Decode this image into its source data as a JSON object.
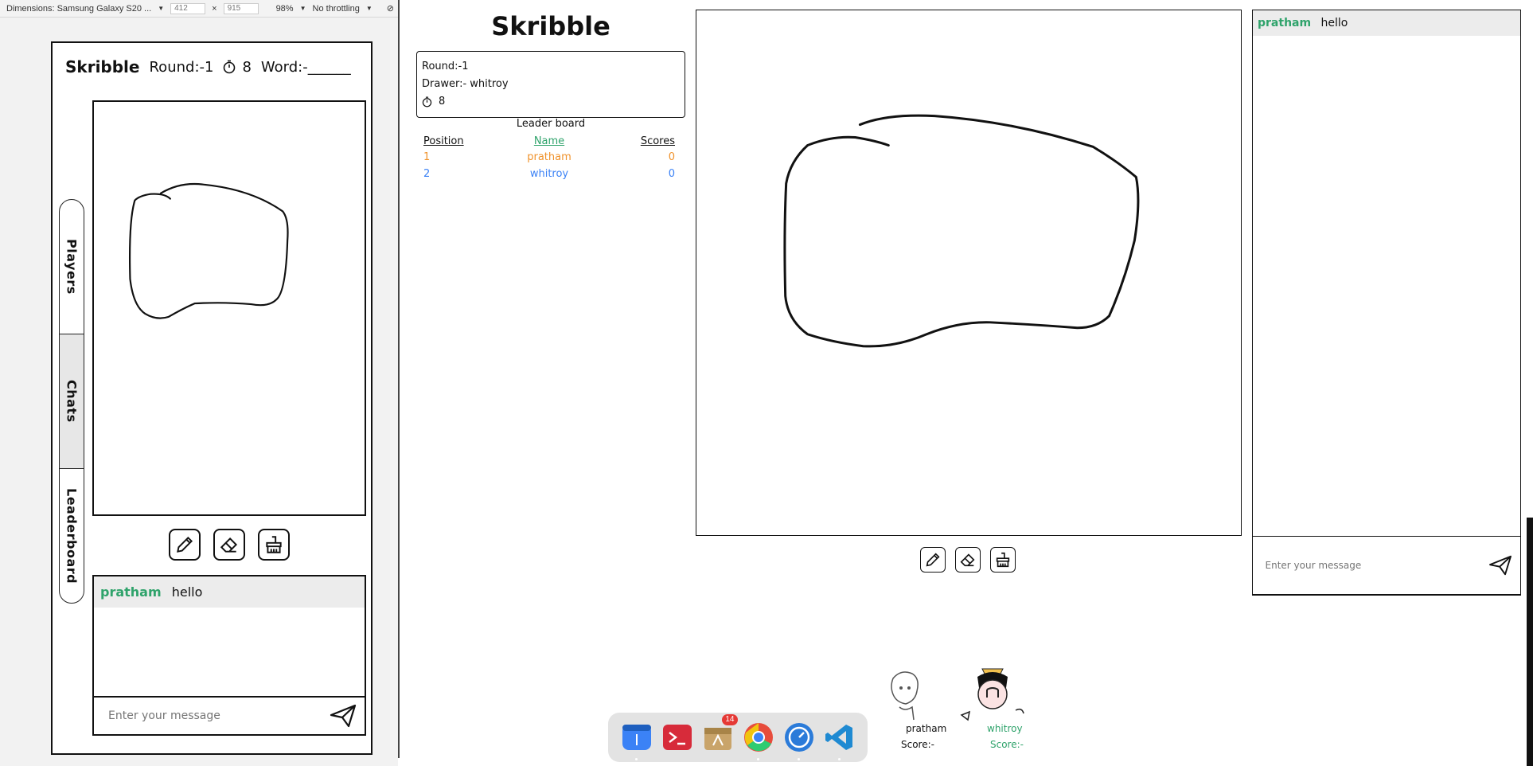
{
  "devtools": {
    "device_label": "Dimensions: Samsung Galaxy S20 ...",
    "width": "412",
    "times": "×",
    "height": "915",
    "zoom": "98%",
    "throttle": "No throttling"
  },
  "mobile": {
    "title": "Skribble",
    "round": "Round:-1",
    "timer": "8",
    "word": "Word:-______",
    "tabs": [
      {
        "label": "Players"
      },
      {
        "label": "Chats"
      },
      {
        "label": "Leaderboard"
      }
    ],
    "chat": {
      "messages": [
        {
          "user": "pratham",
          "text": "hello"
        }
      ],
      "placeholder": "Enter your message"
    }
  },
  "desktop": {
    "title": "Skribble",
    "info": {
      "round": "Round:-1",
      "drawer": "Drawer:- whitroy",
      "timer": "8"
    },
    "leaderboard": {
      "title": "Leader board",
      "headers": [
        "Position",
        "Name",
        "Scores"
      ],
      "rows": [
        {
          "position": "1",
          "name": "pratham",
          "score": "0",
          "color": "#f0922b"
        },
        {
          "position": "2",
          "name": "whitroy",
          "score": "0",
          "color": "#3b82f6"
        }
      ]
    },
    "chat": {
      "messages": [
        {
          "user": "pratham",
          "text": "hello"
        }
      ],
      "placeholder": "Enter your message"
    },
    "players": [
      {
        "name": "pratham",
        "score_label": "Score:-"
      },
      {
        "name": "whitroy",
        "score_label": "Score:-"
      }
    ]
  },
  "dock": {
    "items": [
      {
        "icon": "pen-tablet-icon"
      },
      {
        "icon": "terminal-icon"
      },
      {
        "icon": "archive-icon",
        "badge": "14"
      },
      {
        "icon": "chrome-icon"
      },
      {
        "icon": "timer-app-icon"
      },
      {
        "icon": "vscode-icon"
      }
    ]
  },
  "colors": {
    "accent_green": "#2fa36b",
    "rank1": "#f0922b",
    "rank2": "#3b82f6"
  }
}
